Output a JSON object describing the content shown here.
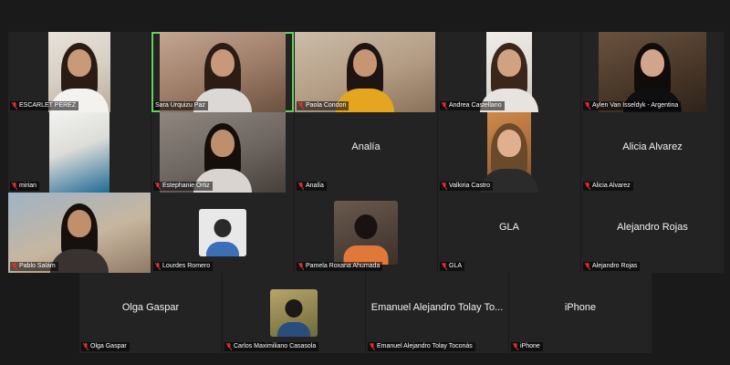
{
  "colors": {
    "background": "#1a1a1a",
    "tile": "#232323",
    "active_speaker_outline": "#5fd35a",
    "muted_mic": "#e02f2f"
  },
  "participants": [
    {
      "name": "ESCARLET PEREZ",
      "display": "",
      "video": true,
      "muted": true,
      "speaking": false
    },
    {
      "name": "Sara Urquizu Paz",
      "display": "",
      "video": true,
      "muted": false,
      "speaking": true
    },
    {
      "name": "Paola Condori",
      "display": "",
      "video": true,
      "muted": true,
      "speaking": false
    },
    {
      "name": "Andrea Castellano",
      "display": "",
      "video": true,
      "muted": true,
      "speaking": false
    },
    {
      "name": "Aylen Van Isseldyk - Argentina",
      "display": "",
      "video": true,
      "muted": true,
      "speaking": false
    },
    {
      "name": "mirian",
      "display": "",
      "video": true,
      "muted": true,
      "speaking": false
    },
    {
      "name": "Estephanie Ortiz",
      "display": "",
      "video": true,
      "muted": true,
      "speaking": false
    },
    {
      "name": "Analía",
      "display": "Analía",
      "video": false,
      "muted": true,
      "speaking": false
    },
    {
      "name": "Valkiria Castro",
      "display": "",
      "video": true,
      "muted": true,
      "speaking": false
    },
    {
      "name": "Alicia Alvarez",
      "display": "Alicia Alvarez",
      "video": false,
      "muted": true,
      "speaking": false
    },
    {
      "name": "Pablo Salám",
      "display": "",
      "video": true,
      "muted": true,
      "speaking": false
    },
    {
      "name": "Lourdes Romero",
      "display": "",
      "video": false,
      "photo": true,
      "muted": true,
      "speaking": false
    },
    {
      "name": "Pamela Roxana Ahumada",
      "display": "",
      "video": false,
      "photo": true,
      "muted": true,
      "speaking": false
    },
    {
      "name": "GLA",
      "display": "GLA",
      "video": false,
      "muted": true,
      "speaking": false
    },
    {
      "name": "Alejandro Rojas",
      "display": "Alejandro Rojas",
      "video": false,
      "muted": true,
      "speaking": false
    },
    {
      "name": "Olga Gaspar",
      "display": "Olga Gaspar",
      "video": false,
      "muted": true,
      "speaking": false
    },
    {
      "name": "Carlos Maximiliano Casasola",
      "display": "",
      "video": false,
      "photo": true,
      "muted": true,
      "speaking": false
    },
    {
      "name": "Emanuel Alejandro Tolay Toconás",
      "display": "Emanuel Alejandro Tolay To...",
      "video": false,
      "muted": true,
      "speaking": false
    },
    {
      "name": "iPhone",
      "display": "iPhone",
      "video": false,
      "muted": true,
      "speaking": false
    }
  ]
}
